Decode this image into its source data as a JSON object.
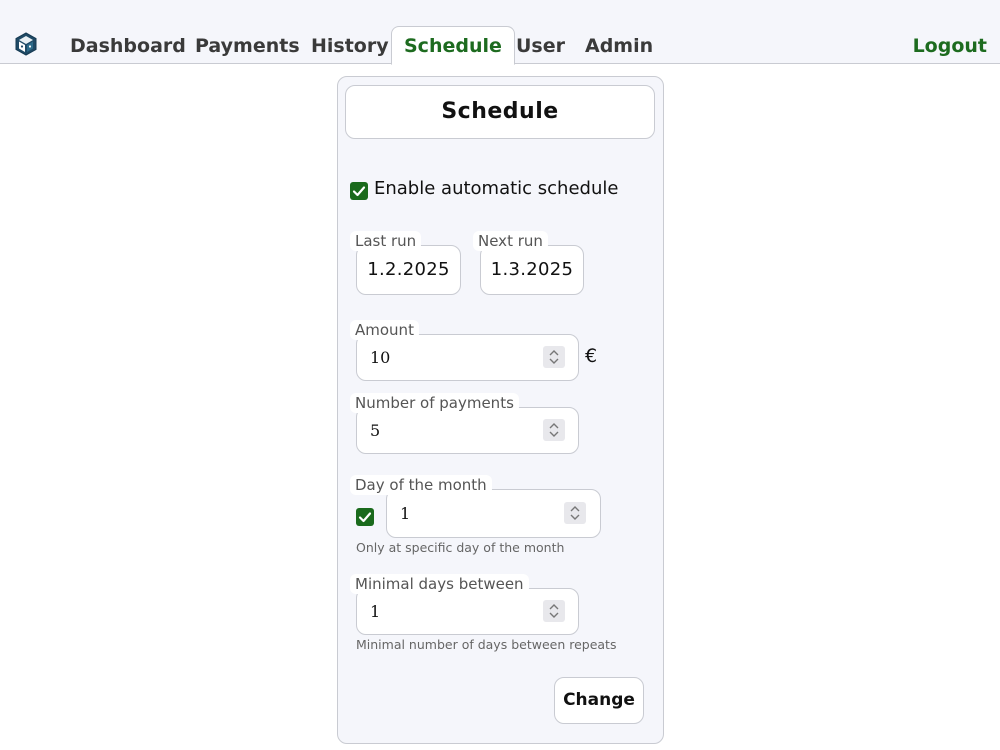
{
  "nav": {
    "tabs": [
      {
        "label": "Dashboard"
      },
      {
        "label": "Payments"
      },
      {
        "label": "History"
      },
      {
        "label": "Schedule"
      },
      {
        "label": "User"
      },
      {
        "label": "Admin"
      }
    ],
    "active_tab": "Schedule",
    "logout_label": "Logout",
    "logo_icon": "cube-icon"
  },
  "schedule": {
    "title": "Schedule",
    "enable_label": "Enable automatic schedule",
    "enable_checked": true,
    "last_run": {
      "label": "Last run",
      "value": "1.2.2025"
    },
    "next_run": {
      "label": "Next run",
      "value": "1.3.2025"
    },
    "amount": {
      "label": "Amount",
      "value": "10",
      "currency": "€"
    },
    "num_payments": {
      "label": "Number of payments",
      "value": "5"
    },
    "day_of_month": {
      "label": "Day of the month",
      "checked": true,
      "value": "1",
      "hint": "Only at specific day of the month"
    },
    "min_days": {
      "label": "Minimal days between",
      "value": "1",
      "hint": "Minimal number of days between repeats"
    },
    "change_label": "Change"
  },
  "colors": {
    "accent_green": "#1d6b1f",
    "panel_bg": "#f5f6fb",
    "border": "#c9cbd2"
  }
}
